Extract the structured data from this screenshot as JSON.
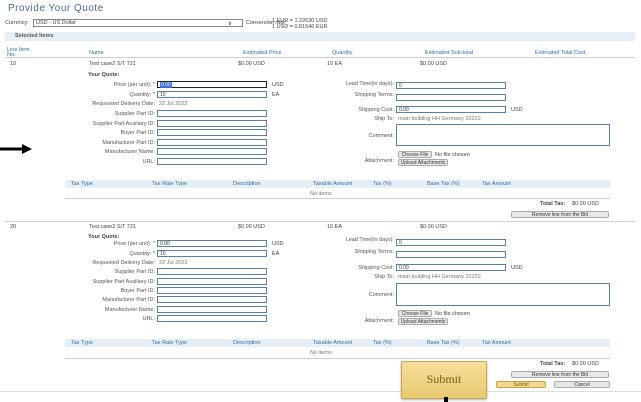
{
  "page": {
    "title": "Provide Your Quote"
  },
  "currency": {
    "label": "Currency:",
    "value": "USD - US Dollar",
    "rate_label": "Conversion rate:",
    "rate_line1": "1 EUR = 1.22630 USD",
    "rate_line2": "1 USD = 0.81546 EUR"
  },
  "section": {
    "title": "Selected Items"
  },
  "columns": {
    "line": "Line Item No.",
    "name": "Name",
    "est_price": "Estimated Price",
    "quantity": "Quantity",
    "est_subtotal": "Estimated Sub-total",
    "est_total": "Estimated Total Cost"
  },
  "items": [
    {
      "no": "10",
      "name": "Test case2 S/T 721",
      "est_price": "$0.00 USD",
      "qty": "10 EA",
      "subtotal": "$0.00 USD",
      "your_quote": "Your Quote:",
      "price_label": "Price (per unit): *",
      "price_value": "0.00",
      "price_unit": "USD",
      "qty_label": "Quantity: *",
      "qty_value": "10",
      "qty_unit": "EA",
      "delivery_label": "Requested Delivery Date:",
      "delivery_value": "22 Jul 2022",
      "supplier_part_label": "Supplier Part ID:",
      "aux_label": "Supplier Part Auxiliary ID:",
      "buyer_label": "Buyer Part ID:",
      "mfr_part_label": "Manufacturer Part ID:",
      "mfr_name_label": "Manufacturer Name:",
      "url_label": "URL:",
      "lead_label": "Lead Time(in days):",
      "lead_value": "0",
      "ship_terms_label": "Shipping Terms:",
      "ship_cost_label": "Shipping Cost:",
      "ship_cost_value": "0.00",
      "ship_cost_unit": "USD",
      "ship_to_label": "Ship To:",
      "ship_to_value": "main building HH Germany 22222",
      "comment_label": "Comment:",
      "attach_label": "Attachment:",
      "choose_file": "Choose File",
      "no_file": "No file chosen",
      "upload": "Upload Attachments",
      "tax_cols": [
        "Tax Type",
        "Tax Rate Type",
        "Description",
        "Taxable Amount",
        "Tax (%)",
        "Base Tax (%)",
        "Tax Amount"
      ],
      "no_items": "No items",
      "total_tax_label": "Total Tax:",
      "total_tax_value": "$0.00 USD",
      "remove": "Remove line from the Bid"
    },
    {
      "no": "20",
      "name": "Test case2 S/T 721",
      "est_price": "$0.00 USD",
      "qty": "10 EA",
      "subtotal": "$0.00 USD",
      "your_quote": "Your Quote:",
      "price_label": "Price (per unit): *",
      "price_value": "0.00",
      "price_unit": "USD",
      "qty_label": "Quantity: *",
      "qty_value": "10",
      "qty_unit": "EA",
      "delivery_label": "Requested Delivery Date:",
      "delivery_value": "22 Jul 2022",
      "supplier_part_label": "Supplier Part ID:",
      "aux_label": "Supplier Part Auxiliary ID:",
      "buyer_label": "Buyer Part ID:",
      "mfr_part_label": "Manufacturer Part ID:",
      "mfr_name_label": "Manufacturer Name:",
      "url_label": "URL:",
      "lead_label": "Lead Time(in days):",
      "lead_value": "0",
      "ship_terms_label": "Shipping Terms:",
      "ship_cost_label": "Shipping Cost:",
      "ship_cost_value": "0.00",
      "ship_cost_unit": "USD",
      "ship_to_label": "Ship To:",
      "ship_to_value": "main building HH Germany 22222",
      "comment_label": "Comment:",
      "attach_label": "Attachment:",
      "choose_file": "Choose File",
      "no_file": "No file chosen",
      "upload": "Upload Attachments",
      "tax_cols": [
        "Tax Type",
        "Tax Rate Type",
        "Description",
        "Taxable Amount",
        "Tax (%)",
        "Base Tax (%)",
        "Tax Amount"
      ],
      "no_items": "No items",
      "total_tax_label": "Total Tax:",
      "total_tax_value": "$0.00 USD",
      "remove": "Remove line from the Bid"
    }
  ],
  "footer": {
    "submit": "Submit",
    "cancel": "Cancel"
  },
  "callout": {
    "label": "Submit",
    "color": "#f2d48a"
  }
}
